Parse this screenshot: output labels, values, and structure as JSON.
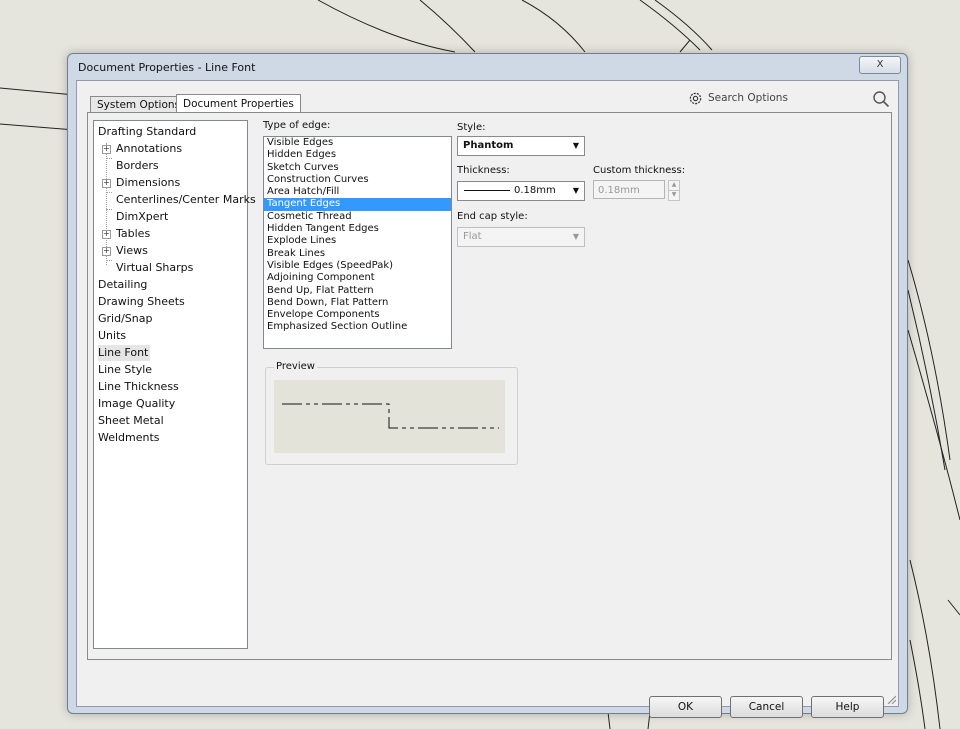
{
  "window": {
    "title": "Document Properties - Line Font",
    "close_glyph": "X"
  },
  "tabs": [
    {
      "label": "System Options"
    },
    {
      "label": "Document Properties"
    }
  ],
  "search": {
    "label": "Search Options",
    "icon": "gear-icon",
    "search_icon": "magnifier-icon"
  },
  "tree": {
    "items": [
      {
        "label": "Drafting Standard"
      },
      {
        "label": "Annotations"
      },
      {
        "label": "Borders"
      },
      {
        "label": "Dimensions"
      },
      {
        "label": "Centerlines/Center Marks"
      },
      {
        "label": "DimXpert"
      },
      {
        "label": "Tables"
      },
      {
        "label": "Views"
      },
      {
        "label": "Virtual Sharps"
      },
      {
        "label": "Detailing"
      },
      {
        "label": "Drawing Sheets"
      },
      {
        "label": "Grid/Snap"
      },
      {
        "label": "Units"
      },
      {
        "label": "Line Font",
        "selected": true
      },
      {
        "label": "Line Style"
      },
      {
        "label": "Line Thickness"
      },
      {
        "label": "Image Quality"
      },
      {
        "label": "Sheet Metal"
      },
      {
        "label": "Weldments"
      }
    ]
  },
  "edge_type": {
    "label": "Type of edge:",
    "selected": "Tangent Edges",
    "items": [
      "Visible Edges",
      "Hidden Edges",
      "Sketch Curves",
      "Construction Curves",
      "Area Hatch/Fill",
      "Tangent Edges",
      "Cosmetic Thread",
      "Hidden Tangent Edges",
      "Explode Lines",
      "Break Lines",
      "Visible Edges (SpeedPak)",
      "Adjoining Component",
      "Bend Up, Flat Pattern",
      "Bend Down, Flat Pattern",
      "Envelope Components",
      "Emphasized Section Outline"
    ]
  },
  "style": {
    "label": "Style:",
    "value": "Phantom"
  },
  "thickness": {
    "label": "Thickness:",
    "value": "0.18mm"
  },
  "custom_thickness": {
    "label": "Custom thickness:",
    "value": "0.18mm"
  },
  "end_cap": {
    "label": "End cap style:",
    "value": "Flat"
  },
  "preview": {
    "label": "Preview"
  },
  "buttons": {
    "ok": "OK",
    "cancel": "Cancel",
    "help": "Help"
  },
  "colors": {
    "selection": "#3399ff",
    "dialog_frame": "#cfd9e6",
    "preview_bg": "#e4e3da"
  }
}
